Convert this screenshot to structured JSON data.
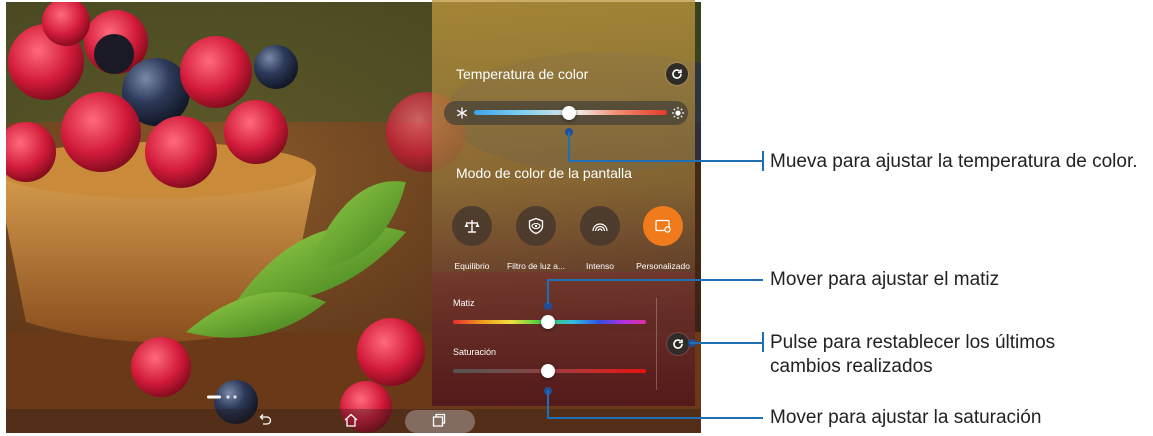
{
  "panel": {
    "temperature_title": "Temperatura de color",
    "screen_mode_title": "Modo de color de la pantalla",
    "temperature_level": 0.49,
    "modes": [
      {
        "label": "Equilibrio",
        "icon": "balance-icon",
        "active": false
      },
      {
        "label": "Filtro de luz a...",
        "icon": "eye-shield-icon",
        "active": false
      },
      {
        "label": "Intenso",
        "icon": "rainbow-icon",
        "active": false
      },
      {
        "label": "Personalizado",
        "icon": "custom-screen-icon",
        "active": true
      }
    ],
    "hue_label": "Matiz",
    "hue_level": 0.49,
    "saturation_label": "Saturación",
    "saturation_level": 0.49
  },
  "callouts": {
    "temperature": "Mueva para ajustar la temperatura de color.",
    "hue": "Mover para ajustar el matiz",
    "reset": "Pulse para restablecer los últimos cambios realizados",
    "saturation": "Mover para ajustar la saturación"
  },
  "colors": {
    "accent": "#f07a1c",
    "callout_line": "#1f6fb5"
  }
}
